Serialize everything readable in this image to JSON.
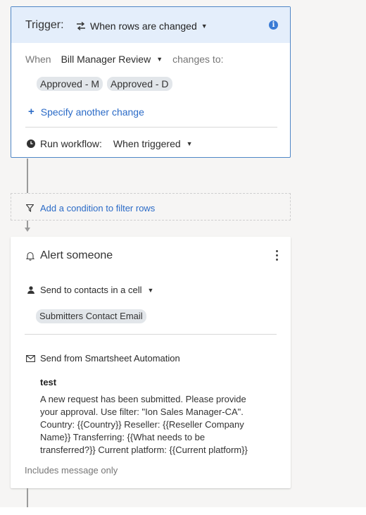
{
  "trigger": {
    "title": "Trigger:",
    "type_label": "When rows are changed",
    "when_label": "When",
    "column_name": "Bill Manager Review",
    "changes_to_label": "changes to:",
    "values": [
      "Approved - M",
      "Approved - D"
    ],
    "add_change_label": "Specify another change",
    "run_label": "Run workflow:",
    "run_value": "When triggered"
  },
  "filter": {
    "label": "Add a condition to filter rows"
  },
  "alert": {
    "title": "Alert someone",
    "recipient_type": "Send to contacts in a cell",
    "recipient_column": "Submitters Contact Email",
    "sender": "Send from Smartsheet Automation",
    "subject": "test",
    "message_lines": [
      "A new request has been submitted. Please provide",
      "your approval. Use filter: \"Ion Sales Manager-CA\".",
      "Country: {{Country}} Reseller: {{Reseller Company",
      "Name}} Transferring: {{What needs to be",
      "transferred?}} Current platform: {{Current platform}}"
    ],
    "includes_label": "Includes message only"
  }
}
